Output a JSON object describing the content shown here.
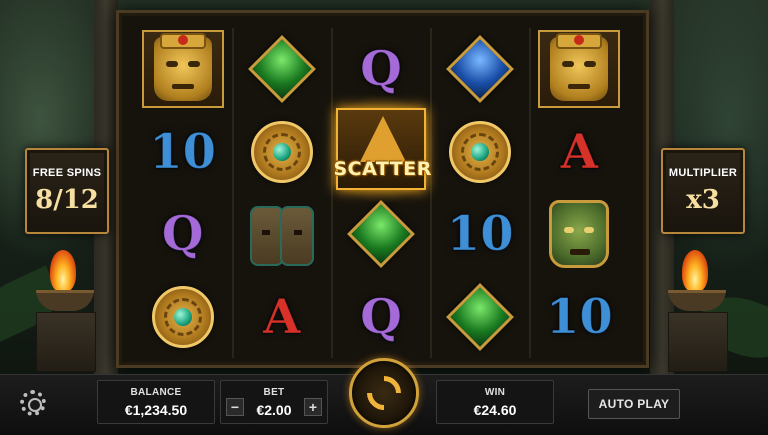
{
  "left_panel": {
    "label": "FREE SPINS",
    "value": "8/12"
  },
  "right_panel": {
    "label": "MULTIPLIER",
    "value": "x3"
  },
  "reels": [
    [
      "mask-gold-icon",
      "ten",
      "queen",
      "gold-coin-icon"
    ],
    [
      "gem-green-icon",
      "gold-coin-icon",
      "mask-stone-icon",
      "ace"
    ],
    [
      "queen",
      "scatter",
      "gem-green-icon",
      "queen"
    ],
    [
      "gem-blue-icon",
      "gold-coin-icon",
      "ten",
      "gem-green-icon"
    ],
    [
      "mask-gold-icon",
      "ace",
      "mask-green-icon",
      "ten"
    ]
  ],
  "symbols": {
    "ten": "10",
    "queen": "Q",
    "ace": "A",
    "scatter": "SCATTER"
  },
  "colors": {
    "ten": "#3f8fd6",
    "queen": "#a46ad8",
    "ace": "#d6322a",
    "gold": "#c89b3c"
  },
  "footer": {
    "balance_label": "BALANCE",
    "balance_value": "€1,234.50",
    "bet_label": "BET",
    "bet_value": "€2.00",
    "bet_minus": "−",
    "bet_plus": "+",
    "win_label": "WIN",
    "win_value": "€24.60",
    "autoplay_label": "AUTO PLAY"
  }
}
